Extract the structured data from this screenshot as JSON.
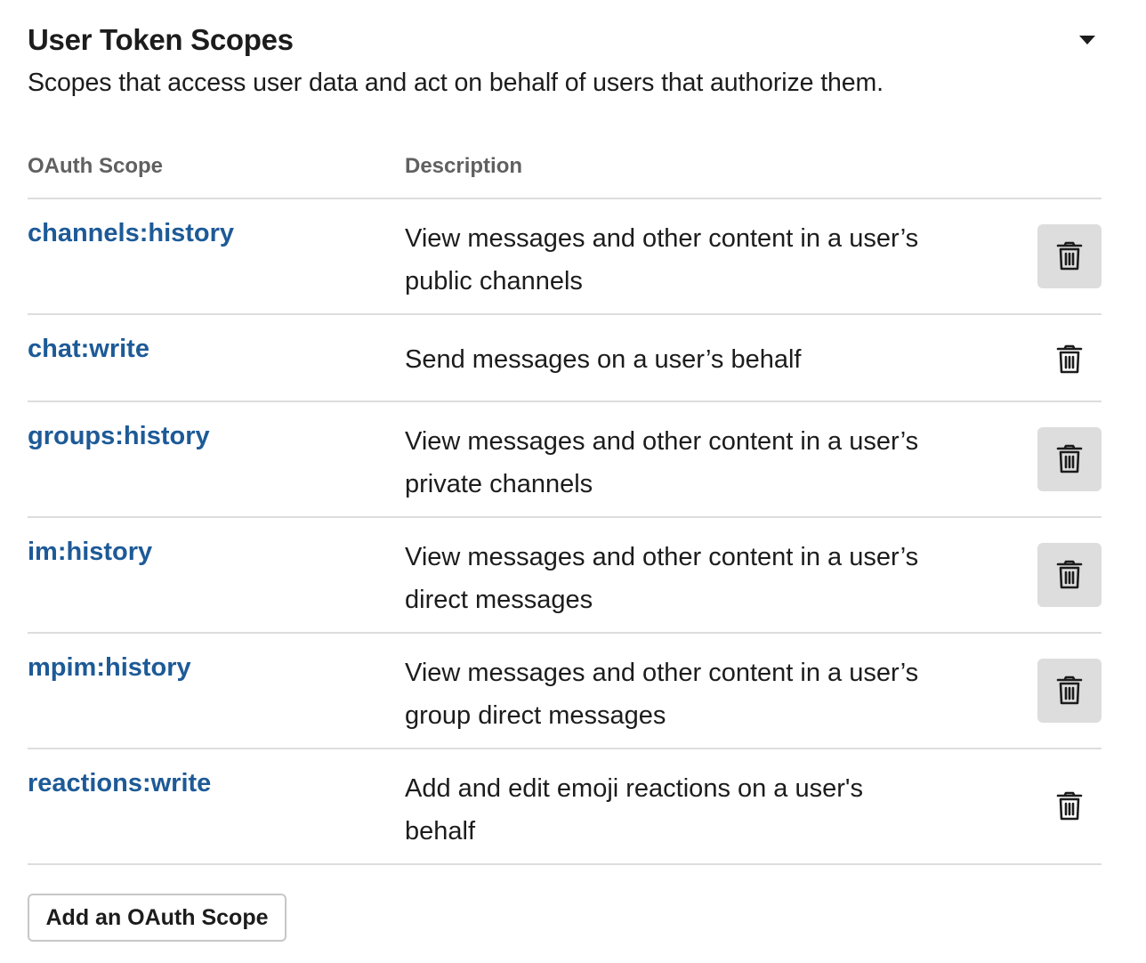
{
  "section": {
    "title": "User Token Scopes",
    "subtitle": "Scopes that access user data and act on behalf of users that authorize them.",
    "toggle_icon": "caret-down-icon"
  },
  "table": {
    "columns": [
      "OAuth Scope",
      "Description"
    ],
    "rows": [
      {
        "scope": "channels:history",
        "description": "View messages and other content in a user’s public channels",
        "delete_icon": "trash-icon",
        "hovered": true
      },
      {
        "scope": "chat:write",
        "description": "Send messages on a user’s behalf",
        "delete_icon": "trash-icon",
        "hovered": false
      },
      {
        "scope": "groups:history",
        "description": "View messages and other content in a user’s private channels",
        "delete_icon": "trash-icon",
        "hovered": true
      },
      {
        "scope": "im:history",
        "description": "View messages and other content in a user’s direct messages",
        "delete_icon": "trash-icon",
        "hovered": true
      },
      {
        "scope": "mpim:history",
        "description": "View messages and other content in a user’s group direct messages",
        "delete_icon": "trash-icon",
        "hovered": true
      },
      {
        "scope": "reactions:write",
        "description": "Add and edit emoji reactions on a user's behalf",
        "delete_icon": "trash-icon",
        "hovered": false
      }
    ]
  },
  "actions": {
    "add_scope_label": "Add an OAuth Scope"
  },
  "colors": {
    "link": "#1d5a97",
    "text": "#1d1c1d",
    "muted": "#616061",
    "divider": "#dddddd",
    "button_fill": "#dddddd"
  }
}
